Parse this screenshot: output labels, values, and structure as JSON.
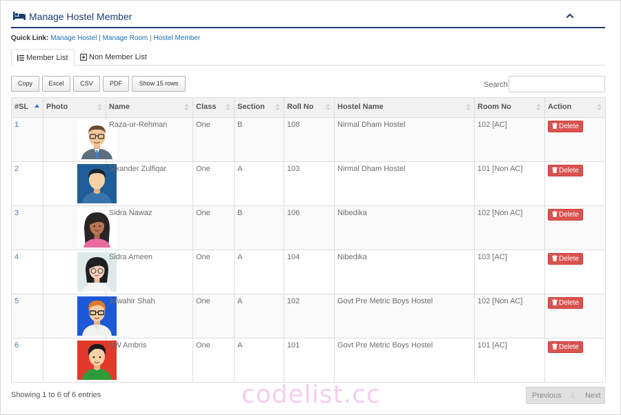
{
  "panel": {
    "title": "Manage Hostel Member",
    "icon": "bed-icon",
    "accent": "#1f3b73"
  },
  "quicklinks": {
    "label": "Quick Link:",
    "links": [
      "Manage Hostel",
      "Manage Room",
      "Hostel Member"
    ],
    "separator": "|"
  },
  "tabs": [
    {
      "label": "Member List",
      "icon": "list-icon",
      "active": true
    },
    {
      "label": "Non Member List",
      "icon": "plus-square-icon",
      "active": false
    }
  ],
  "toolbar": {
    "copy": "Copy",
    "excel": "Excel",
    "csv": "CSV",
    "pdf": "PDF",
    "rows": "Show 15 rows"
  },
  "search": {
    "label": "Search:",
    "value": ""
  },
  "table": {
    "headers": [
      "#SL",
      "Photo",
      "Name",
      "Class",
      "Section",
      "Roll No",
      "Hostel Name",
      "Room No",
      "Action"
    ],
    "rows": [
      {
        "sl": "1",
        "avatar": "avatar-man-glasses",
        "name": "Raza-ur-Rehman",
        "class": "One",
        "section": "B",
        "roll": "108",
        "hostel": "Nirmal Dham Hostel",
        "room": "102 [AC]",
        "action": "Delete"
      },
      {
        "sl": "2",
        "avatar": "avatar-man-blue",
        "name": "Sikander Zulfiqar",
        "class": "One",
        "section": "A",
        "roll": "103",
        "hostel": "Nirmal Dham Hostel",
        "room": "101 [Non AC]",
        "action": "Delete"
      },
      {
        "sl": "3",
        "avatar": "avatar-woman-dark-hair",
        "name": "Sidra Nawaz",
        "class": "One",
        "section": "B",
        "roll": "106",
        "hostel": "Nibedika",
        "room": "102 [Non AC]",
        "action": "Delete"
      },
      {
        "sl": "4",
        "avatar": "avatar-woman-glasses",
        "name": "Sidra Ameen",
        "class": "One",
        "section": "A",
        "roll": "104",
        "hostel": "Nibedika",
        "room": "103 [AC]",
        "action": "Delete"
      },
      {
        "sl": "5",
        "avatar": "avatar-man-orange-hair",
        "name": "Jawahir Shah",
        "class": "One",
        "section": "A",
        "roll": "102",
        "hostel": "Govt Pre Metric Boys Hostel",
        "room": "102 [Non AC]",
        "action": "Delete"
      },
      {
        "sl": "6",
        "avatar": "avatar-man-green-shirt",
        "name": "SW Ambris",
        "class": "One",
        "section": "A",
        "roll": "101",
        "hostel": "Govt Pre Metric Boys Hostel",
        "room": "101 [AC]",
        "action": "Delete"
      }
    ]
  },
  "footer": {
    "info": "Showing 1 to 6 of 6 entries",
    "previous": "Previous",
    "page": "1",
    "next": "Next"
  },
  "watermark": "codelist.cc",
  "colors": {
    "delete": "#d9534f",
    "link": "#1a6fb5"
  }
}
